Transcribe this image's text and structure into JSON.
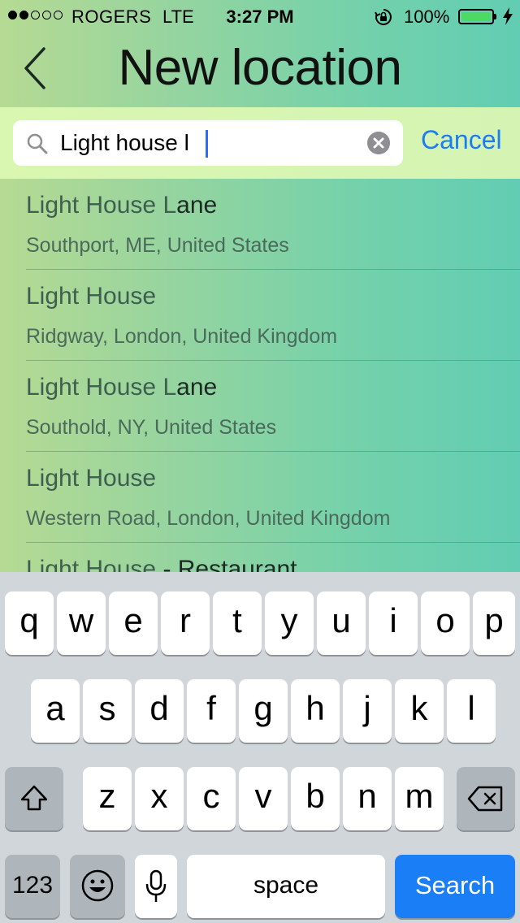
{
  "status_bar": {
    "carrier": "ROGERS",
    "network": "LTE",
    "time": "3:27 PM",
    "battery_percent": "100%",
    "signal_bars_filled": 2,
    "signal_bars_total": 5,
    "battery_level": 1.0,
    "battery_color": "#4cd964"
  },
  "header": {
    "title": "New location",
    "back_icon": "chevron-left-icon"
  },
  "search": {
    "value": "Light house l",
    "cancel_label": "Cancel",
    "accent_color": "#1b7cf6"
  },
  "results": [
    {
      "title_match": "Light House L",
      "title_rest": "ane",
      "subtitle": "Southport, ME, United States"
    },
    {
      "title_match": "Light House",
      "title_rest": "",
      "subtitle": "Ridgway, London, United Kingdom"
    },
    {
      "title_match": "Light House L",
      "title_rest": "ane",
      "subtitle": "Southold, NY, United States"
    },
    {
      "title_match": "Light House",
      "title_rest": "",
      "subtitle": "Western Road, London, United Kingdom"
    },
    {
      "title_match": "Light House",
      "title_rest": " - Restaurant",
      "subtitle": ""
    }
  ],
  "keyboard": {
    "row1": [
      "q",
      "w",
      "e",
      "r",
      "t",
      "y",
      "u",
      "i",
      "o",
      "p"
    ],
    "row2": [
      "a",
      "s",
      "d",
      "f",
      "g",
      "h",
      "j",
      "k",
      "l"
    ],
    "row3": [
      "z",
      "x",
      "c",
      "v",
      "b",
      "n",
      "m"
    ],
    "numbers_label": "123",
    "space_label": "space",
    "search_label": "Search",
    "shift_icon": "shift-icon",
    "delete_icon": "backspace-icon",
    "emoji_icon": "emoji-icon",
    "mic_icon": "microphone-icon"
  }
}
